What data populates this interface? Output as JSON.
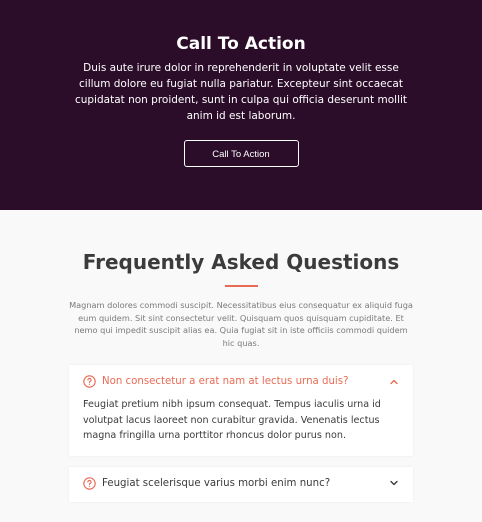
{
  "cta": {
    "title": "Call To Action",
    "text": "Duis aute irure dolor in reprehenderit in voluptate velit esse cillum dolore eu fugiat nulla pariatur. Excepteur sint occaecat cupidatat non proident, sunt in culpa qui officia deserunt mollit anim id est laborum.",
    "button_label": "Call To Action"
  },
  "faq": {
    "title": "Frequently Asked Questions",
    "intro": "Magnam dolores commodi suscipit. Necessitatibus eius consequatur ex aliquid fuga eum quidem. Sit sint consectetur velit. Quisquam quos quisquam cupiditate. Et nemo qui impedit suscipit alias ea. Quia fugiat sit in iste officiis commodi quidem hic quas.",
    "items": [
      {
        "question": "Non consectetur a erat nam at lectus urna duis?",
        "answer": "Feugiat pretium nibh ipsum consequat. Tempus iaculis urna id volutpat lacus laoreet non curabitur gravida. Venenatis lectus magna fringilla urna porttitor rhoncus dolor purus non.",
        "expanded": true,
        "icon": "question-circle-icon"
      },
      {
        "question": "Feugiat scelerisque varius morbi enim nunc?",
        "expanded": false,
        "icon": "question-circle-icon"
      }
    ]
  },
  "colors": {
    "cta_background": "#2b0d2a",
    "accent": "#e96b56",
    "heading": "#3b3b3b",
    "page_background": "#f9f9f9"
  }
}
